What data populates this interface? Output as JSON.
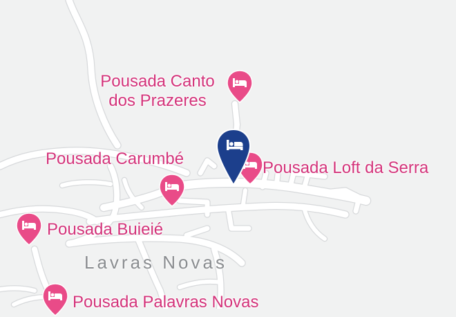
{
  "map": {
    "town_label": "Lavras Novas",
    "colors": {
      "background": "#f1f2f2",
      "road": "#ffffff",
      "road_casing": "#d7d9db",
      "poi_pin": "#e94b88",
      "poi_text": "#d3337a",
      "selected_pin": "#1c3f8c",
      "town_text": "#8a8d90"
    },
    "pois": [
      {
        "id": "canto",
        "icon": "hotel-bed-icon",
        "line1": "Pousada Canto",
        "line2": "dos Prazeres"
      },
      {
        "id": "carumbe",
        "icon": "hotel-bed-icon",
        "label": "Pousada Carumbé"
      },
      {
        "id": "loft",
        "icon": "hotel-bed-icon",
        "label": "Pousada Loft da Serra"
      },
      {
        "id": "buieie",
        "icon": "hotel-bed-icon",
        "label": "Pousada Buieié"
      },
      {
        "id": "palavras",
        "icon": "hotel-bed-icon",
        "label": "Pousada Palavras Novas"
      }
    ],
    "selected_marker": {
      "icon": "hotel-bed-icon"
    }
  }
}
